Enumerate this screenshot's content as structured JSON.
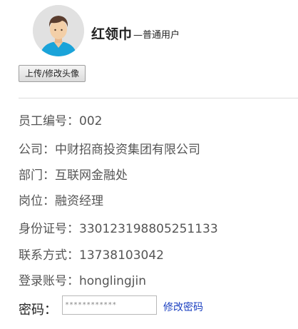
{
  "profile": {
    "name": "红领巾",
    "role": "—普通用户",
    "upload_label": "上传/修改头像"
  },
  "fields": {
    "employee_id": {
      "label": "员工编号：",
      "value": "002"
    },
    "company": {
      "label": "公司：",
      "value": "中财招商投资集团有限公司"
    },
    "department": {
      "label": "部门：",
      "value": "互联网金融处"
    },
    "position": {
      "label": "岗位：",
      "value": "融资经理"
    },
    "id_number": {
      "label": "身份证号：",
      "value": "330123198805251133"
    },
    "contact": {
      "label": "联系方式：",
      "value": "13738103042"
    },
    "account": {
      "label": "登录账号：",
      "value": "honglingjin"
    }
  },
  "password": {
    "label": "密码：",
    "value": "************",
    "change_link": "修改密码"
  },
  "colors": {
    "link": "#1a3fc0",
    "text": "#555555",
    "shirt": "#1aa3d9"
  },
  "icons": {
    "avatar": "user-avatar-icon"
  }
}
